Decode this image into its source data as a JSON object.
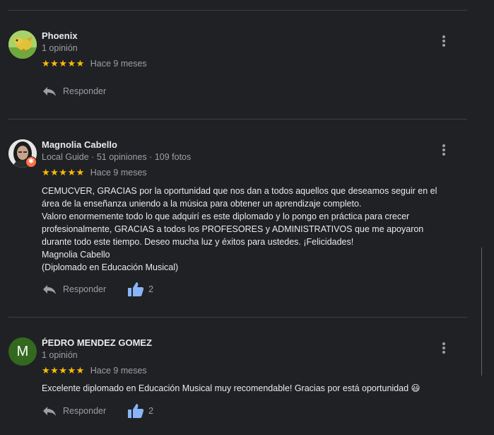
{
  "reviews": [
    {
      "name": "Phoenix",
      "meta": "1 opinión",
      "stars": "★★★★★",
      "date": "Hace 9 meses",
      "text": [],
      "reply_label": "Responder",
      "likes": null
    },
    {
      "name": "Magnolia Cabello",
      "meta": "Local Guide · 51 opiniones · 109 fotos",
      "stars": "★★★★★",
      "date": "Hace 9 meses",
      "text": [
        "CEMUCVER, GRACIAS por la oportunidad que nos dan a todos aquellos que deseamos seguir en el",
        "área de la enseñanza uniendo a la música para obtener un aprendizaje completo.",
        "Valoro enormemente todo lo que adquirí es este diplomado y lo pongo en práctica para crecer",
        "profesionalmente, GRACIAS a todos los PROFESORES y ADMINISTRATIVOS que me apoyaron",
        "durante todo este tiempo. Deseo mucha luz y éxitos para ustedes. ¡Felicidades!",
        "Magnolia Cabello",
        "(Diplomado en Educación Musical)"
      ],
      "reply_label": "Responder",
      "likes": "2"
    },
    {
      "name": "ṔEDRO MENDEZ GOMEZ",
      "meta": "1 opinión",
      "avatar_letter": "M",
      "stars": "★★★★★",
      "date": "Hace 9 meses",
      "text": [
        "Excelente diplomado en Educación Musical muy recomendable! Gracias por está oportunidad 😃"
      ],
      "reply_label": "Responder",
      "likes": "2"
    }
  ],
  "colors": {
    "background": "#202124",
    "star": "#fbbc04",
    "like_icon": "#8ab4f8",
    "avatar_m": "#33691e",
    "local_guide_badge": "#ff7043"
  },
  "icons": {
    "reply": "reply-arrow-icon",
    "like": "thumbs-up-icon",
    "more": "more-vert-icon"
  }
}
